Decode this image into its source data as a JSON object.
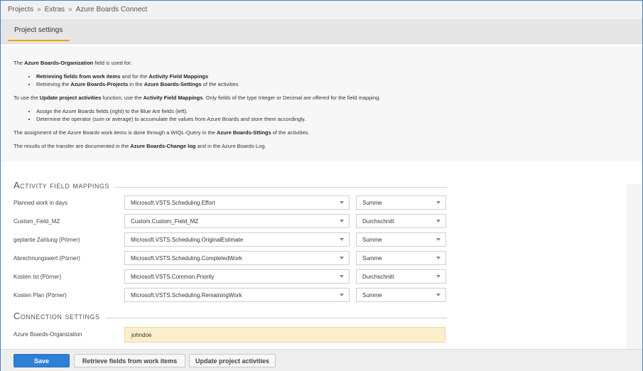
{
  "breadcrumb": {
    "items": [
      "Projects",
      "Extras",
      "Azure Boards Connect"
    ],
    "separator": "»"
  },
  "tabs": [
    {
      "label": "Project settings",
      "active": true
    }
  ],
  "info": {
    "p1_a": "The ",
    "p1_b": "Azure Boards-Organization",
    "p1_c": " field is used for:",
    "list1": [
      {
        "a": "Retrieving fields from work items",
        "b": " and for the ",
        "c": "Activity Field Mappings"
      },
      {
        "a": "Retrieving the ",
        "b": "Azure Boards-Projects",
        "c": " in the ",
        "d": "Azure Boards-Settings",
        "e": " of the activities"
      }
    ],
    "p2_a": "To use the ",
    "p2_b": "Update project activities",
    "p2_c": " function, use the ",
    "p2_d": "Activity Field Mappings",
    "p2_e": ". Only fields of the type Integer or Decimal are offered for the field mapping.",
    "list2": [
      "Assign the Azure Boards fields (right) to the Blue Ant fields (left).",
      "Determine the operator (sum or average) to accumulate the values from Azure Boards and store them accordingly."
    ],
    "p3_a": "The assignment of the Azure Boards work items is done through a WIQL-Query in the ",
    "p3_b": "Azure Boards-Sttings",
    "p3_c": " of the activities.",
    "p4_a": "The results of the transfer are documented in the ",
    "p4_b": "Azure Boards-Change log",
    "p4_c": " and in the Azure Boards-Log."
  },
  "mappings_title": "Activity field mappings",
  "mappings": [
    {
      "label": "Planned work in days",
      "field": "Microsoft.VSTS.Scheduling.Effort",
      "operator": "Summe"
    },
    {
      "label": "Custom_Field_MZ",
      "field": "Custom.Custom_Field_MZ",
      "operator": "Durchschnitt"
    },
    {
      "label": "geplante Zahlung (Pörner)",
      "field": "Microsoft.VSTS.Scheduling.OriginalEstimate",
      "operator": "Summe"
    },
    {
      "label": "Abrechnungswert (Pörner)",
      "field": "Microsoft.VSTS.Scheduling.CompletedWork",
      "operator": "Summe"
    },
    {
      "label": "Kosten Ist (Pörner)",
      "field": "Microsoft.VSTS.Common.Priority",
      "operator": "Durchschnitt"
    },
    {
      "label": "Kosten Plan (Pörner)",
      "field": "Microsoft.VSTS.Scheduling.RemainingWork",
      "operator": "Summe"
    }
  ],
  "connection_title": "Connection settings",
  "connection": {
    "org_label": "Azure Boards-Organization",
    "org_value": "johndoe"
  },
  "buttons": {
    "save": "Save",
    "retrieve": "Retrieve fields from work items",
    "update": "Update project activities"
  },
  "colors": {
    "primary": "#2f7fd8",
    "tab_accent": "#f0a000",
    "input_highlight": "#fbeecb"
  }
}
